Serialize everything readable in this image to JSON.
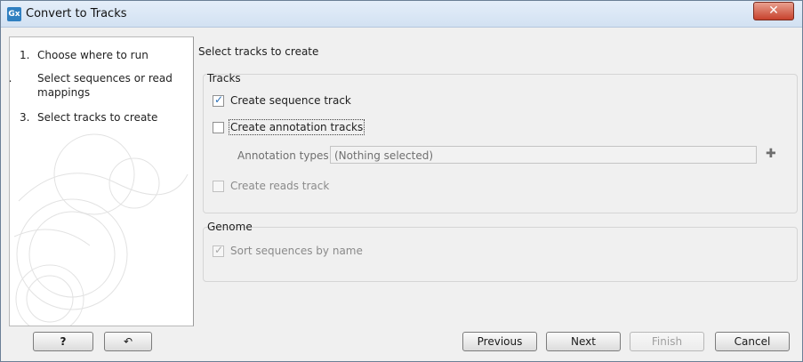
{
  "window": {
    "title": "Convert to Tracks",
    "app_icon_label": "Gx"
  },
  "steps": [
    {
      "num": "1.",
      "label": "Choose where to run"
    },
    {
      "num": "2.",
      "label": "Select sequences or read mappings"
    },
    {
      "num": "3.",
      "label": "Select tracks to create"
    }
  ],
  "main": {
    "header": "Select tracks to create",
    "tracks_group": {
      "title": "Tracks",
      "create_sequence_track": {
        "label": "Create sequence track",
        "checked": true
      },
      "create_annotation_tracks": {
        "label": "Create annotation tracks",
        "checked": false
      },
      "annotation_types": {
        "label": "Annotation types",
        "value": "(Nothing selected)"
      },
      "create_reads_track": {
        "label": "Create reads track",
        "checked": false,
        "disabled": true
      }
    },
    "genome_group": {
      "title": "Genome",
      "sort_sequences": {
        "label": "Sort sequences by name",
        "checked": true,
        "disabled": true
      }
    }
  },
  "footer": {
    "help_label": "?",
    "previous_label": "Previous",
    "next_label": "Next",
    "finish_label": "Finish",
    "cancel_label": "Cancel"
  },
  "icons": {
    "close": "close-icon",
    "reset": "reset-icon",
    "plus": "plus-icon"
  },
  "colors": {
    "titlebar": "#d2e1f2",
    "close_button": "#c7422d",
    "check": "#2a6fb7"
  }
}
